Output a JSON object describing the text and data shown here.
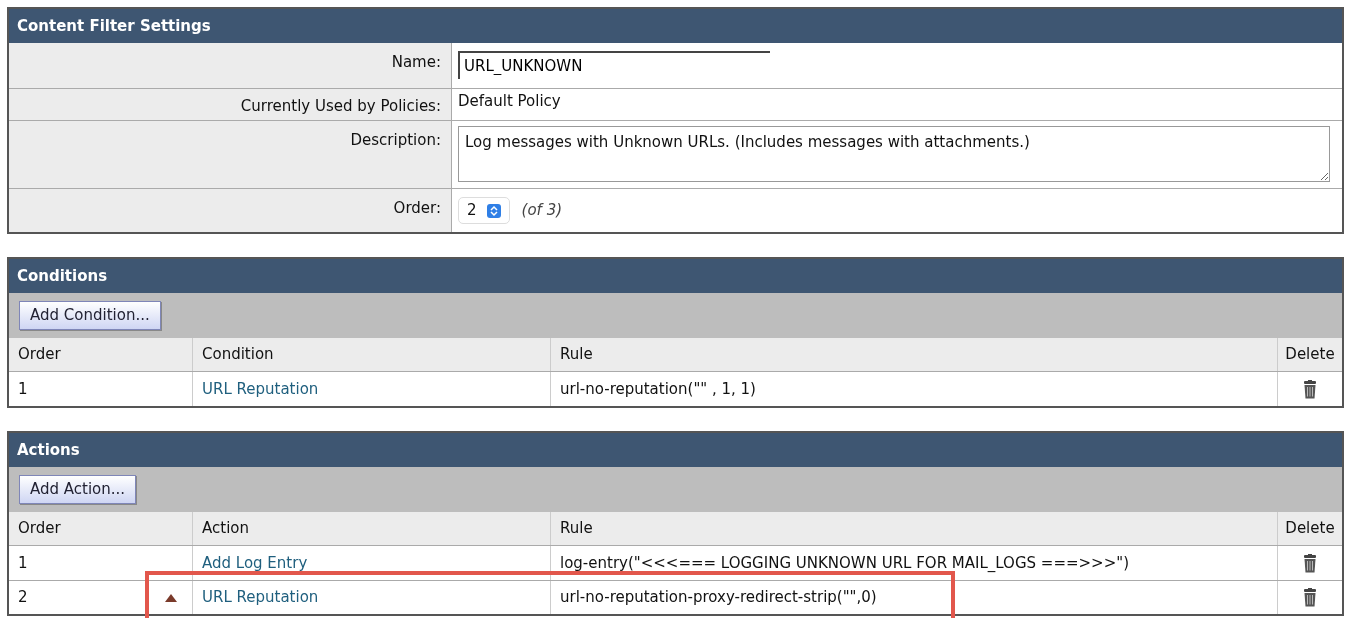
{
  "settings": {
    "title": "Content Filter Settings",
    "fields": [
      {
        "kind": "input",
        "label": "Name:",
        "value": "URL_UNKNOWN"
      },
      {
        "kind": "text",
        "label": "Currently Used by Policies:",
        "value": "Default Policy"
      },
      {
        "kind": "textarea",
        "label": "Description:",
        "value": "Log messages with Unknown URLs. (Includes messages with attachments.)"
      },
      {
        "kind": "select",
        "label": "Order:",
        "value": "2",
        "note": "(of 3)"
      }
    ]
  },
  "conditions": {
    "title": "Conditions",
    "add_button": "Add Condition...",
    "columns": [
      "Order",
      "Condition",
      "Rule",
      "Delete"
    ],
    "rows": [
      {
        "order": "1",
        "name": "URL Reputation",
        "rule": "url-no-reputation(\"\" , 1, 1)"
      }
    ]
  },
  "actions": {
    "title": "Actions",
    "add_button": "Add Action...",
    "columns": [
      "Order",
      "Action",
      "Rule",
      "Delete"
    ],
    "rows": [
      {
        "order": "1",
        "name": "Add Log Entry",
        "rule": "log-entry(\"<<<=== LOGGING UNKNOWN URL FOR MAIL_LOGS ===>>>\")",
        "move_up": false,
        "highlighted": false
      },
      {
        "order": "2",
        "name": "URL Reputation",
        "rule": "url-no-reputation-proxy-redirect-strip(\"\",0)",
        "move_up": true,
        "highlighted": true
      }
    ]
  }
}
